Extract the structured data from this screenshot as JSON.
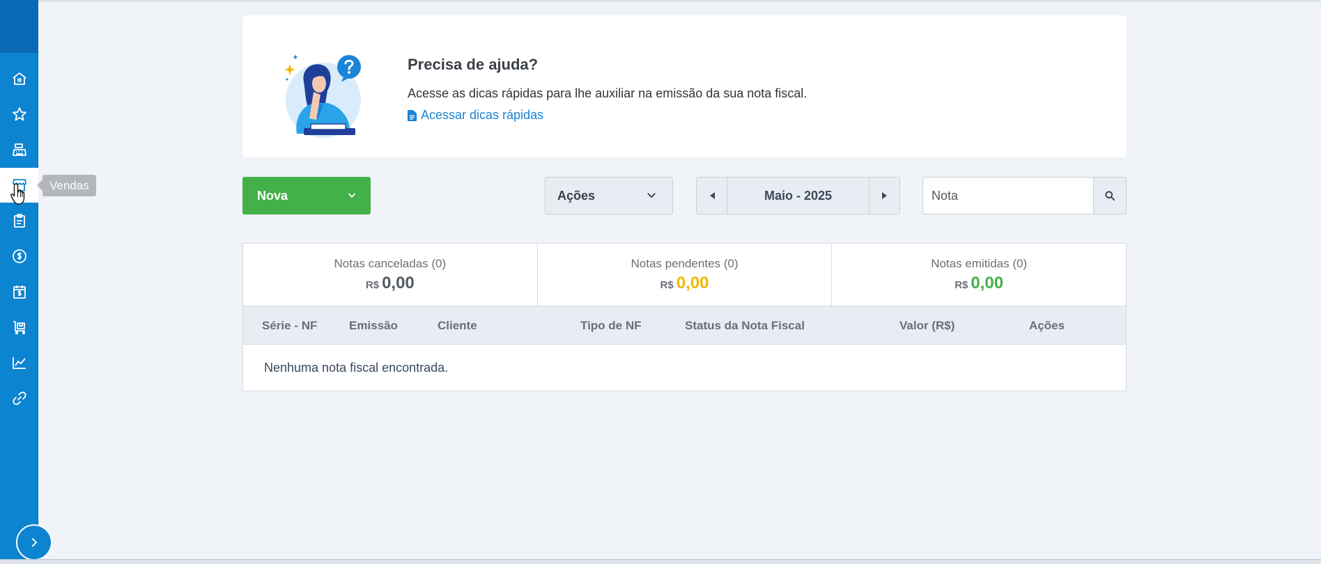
{
  "colors": {
    "sidebar": "#0d84cf",
    "primary_button": "#44b049",
    "link": "#1a84d6",
    "pending": "#f2b705",
    "issued": "#44b049"
  },
  "sidebar": {
    "items": [
      {
        "icon": "home-icon"
      },
      {
        "icon": "star-icon"
      },
      {
        "icon": "cash-register-icon"
      },
      {
        "icon": "store-icon",
        "active": true
      },
      {
        "icon": "clipboard-icon"
      },
      {
        "icon": "dollar-circle-icon"
      },
      {
        "icon": "calendar-dollar-icon"
      },
      {
        "icon": "cart-icon"
      },
      {
        "icon": "chart-line-icon"
      },
      {
        "icon": "link-icon"
      }
    ],
    "tooltip": "Vendas",
    "expand_icon": "chevron-right-icon"
  },
  "help": {
    "title": "Precisa de ajuda?",
    "text": "Acesse as dicas rápidas para lhe auxiliar na emissão da sua nota fiscal.",
    "link_label": "Acessar dicas rápidas"
  },
  "toolbar": {
    "nova_label": "Nova",
    "acoes_label": "Ações",
    "month_label": "Maio - 2025",
    "search_placeholder": "Nota"
  },
  "summary": [
    {
      "label": "Notas canceladas (0)",
      "currency": "R$",
      "value": "0,00",
      "color": "#555a62"
    },
    {
      "label": "Notas pendentes (0)",
      "currency": "R$",
      "value": "0,00",
      "color": "#f2b705"
    },
    {
      "label": "Notas emitidas (0)",
      "currency": "R$",
      "value": "0,00",
      "color": "#44b049"
    }
  ],
  "table": {
    "columns": [
      "Série - NF",
      "Emissão",
      "Cliente",
      "Tipo de NF",
      "Status da Nota Fiscal",
      "Valor (R$)",
      "Ações"
    ],
    "empty_message": "Nenhuma nota fiscal encontrada."
  }
}
